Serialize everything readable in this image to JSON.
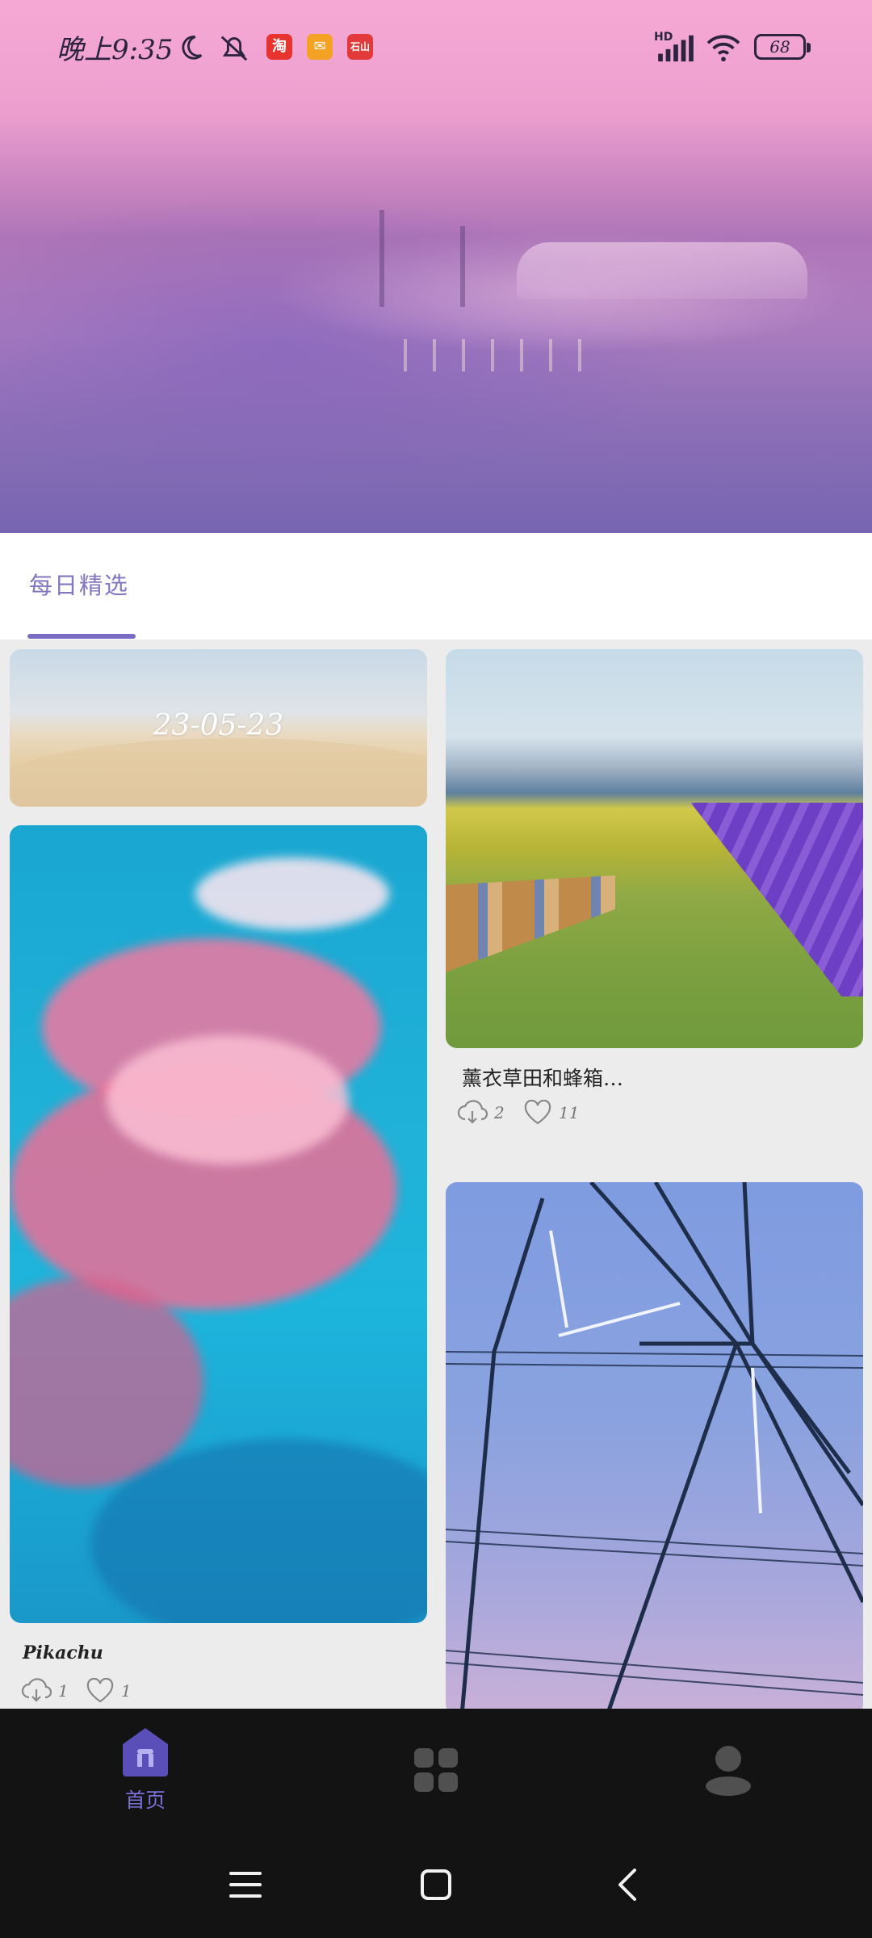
{
  "status_bar": {
    "time": "晚上9:35",
    "icons": [
      "moon-icon",
      "mute-icon",
      "taobao-app-icon",
      "mail-app-icon",
      "calendar-app-icon",
      "signal-icon",
      "wifi-icon",
      "battery-icon"
    ],
    "app_badges": [
      "淘",
      "✉",
      "石山"
    ],
    "network": "HD",
    "battery": "68"
  },
  "tabs": {
    "active": "每日精选"
  },
  "feed": {
    "left": [
      {
        "type": "date",
        "date": "23-05-23"
      },
      {
        "type": "wallpaper",
        "title": "Pikachu",
        "downloads": "1",
        "likes": "1",
        "image": "pink-cloud-sky"
      }
    ],
    "right": [
      {
        "type": "wallpaper",
        "title": "薰衣草田和蜂箱…",
        "downloads": "2",
        "likes": "11",
        "image": "lavender-field-beehives"
      },
      {
        "type": "wallpaper",
        "image": "power-tower"
      }
    ]
  },
  "bottom_nav": {
    "items": [
      {
        "icon": "home-icon",
        "label": "首页",
        "active": true
      },
      {
        "icon": "category-icon",
        "label": ""
      },
      {
        "icon": "profile-icon",
        "label": ""
      }
    ]
  },
  "system_nav": {
    "icons": [
      "menu-icon",
      "home-square-icon",
      "back-icon"
    ]
  },
  "colors": {
    "accent": "#7a6cc4",
    "nav_bg": "#131313",
    "feed_bg": "#ececec"
  }
}
